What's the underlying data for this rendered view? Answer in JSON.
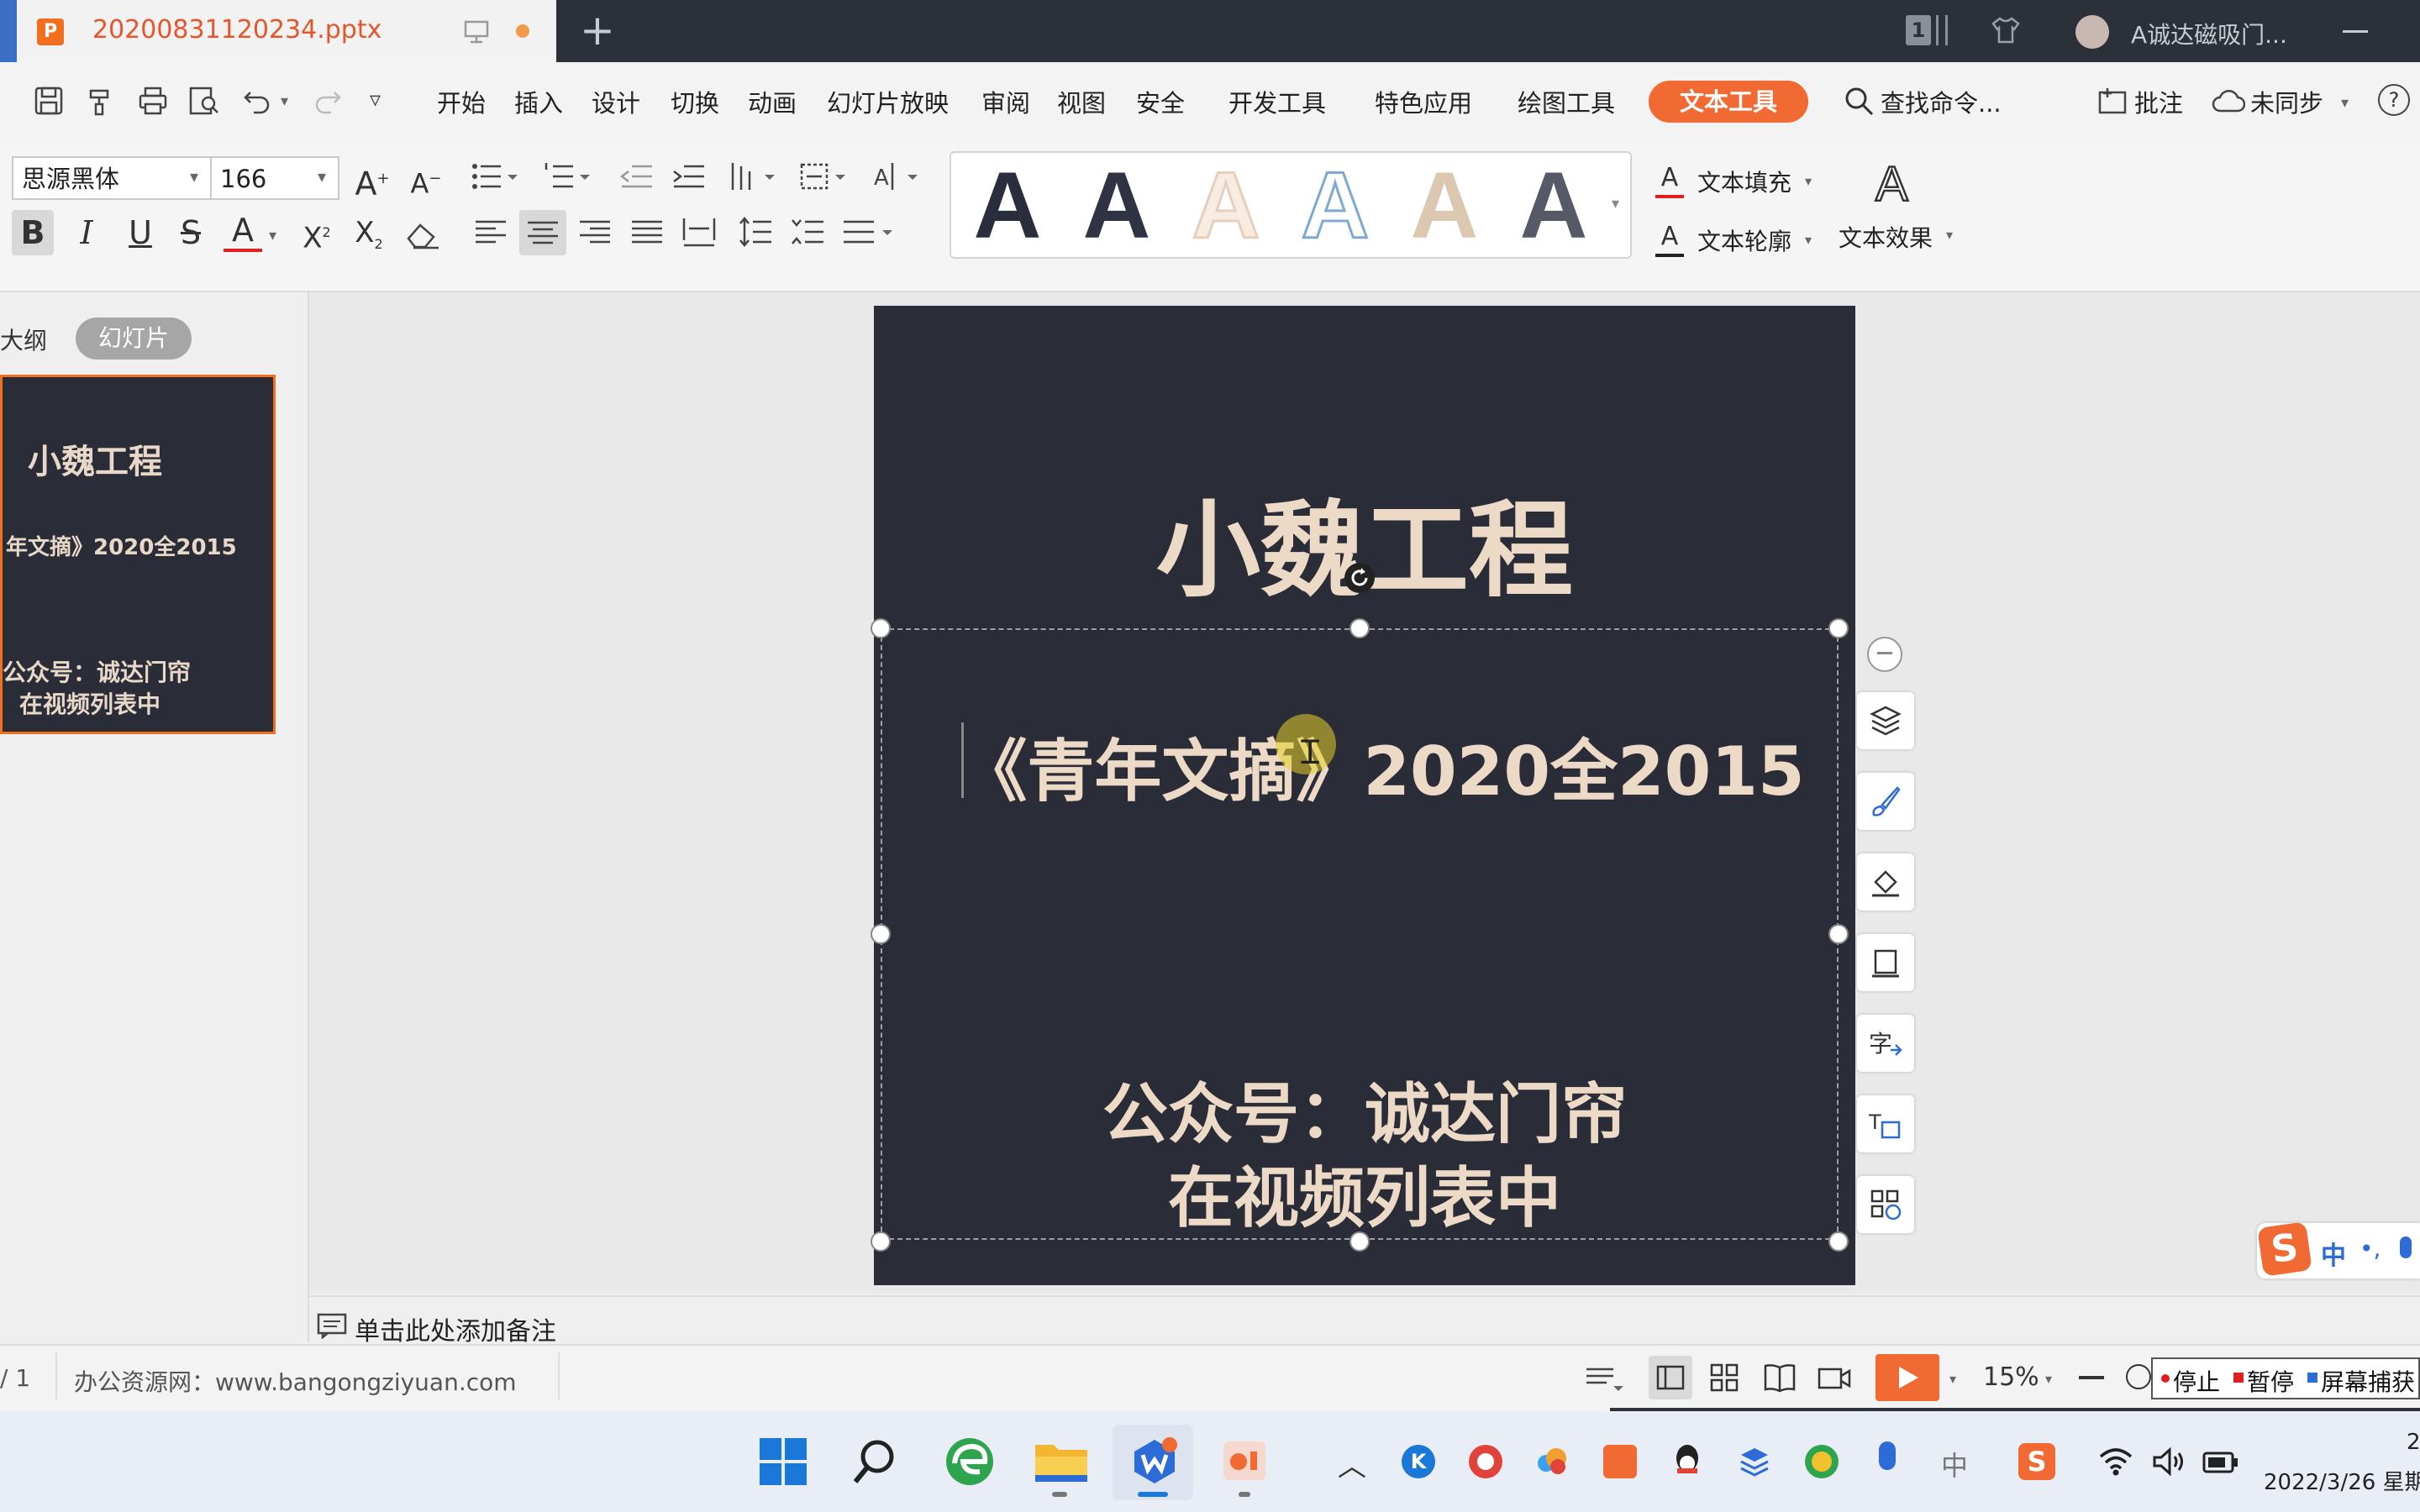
{
  "title_bar": {
    "tab_filename": "20200831120234.pptx",
    "doc_icon_letter": "P",
    "user_label": "A诚达磁吸门...",
    "page_badge": "1"
  },
  "menu": {
    "items": [
      "开始",
      "插入",
      "设计",
      "切换",
      "动画",
      "幻灯片放映",
      "审阅",
      "视图",
      "安全",
      "开发工具",
      "特色应用",
      "绘图工具"
    ],
    "active_tab": "文本工具",
    "search": "查找命令...",
    "comment": "批注",
    "sync": "未同步",
    "help": "?"
  },
  "ribbon": {
    "font_name": "思源黑体",
    "font_size": "166",
    "style_letter": "A",
    "text_fill": "文本填充",
    "text_outline": "文本轮廓",
    "text_effect": "文本效果"
  },
  "left_panel": {
    "tab_outline": "大纲",
    "tab_slides": "幻灯片"
  },
  "slide": {
    "title": "小魏工程",
    "subtitle": "《青年文摘》2020全2015",
    "footer_line1": "公众号：诚达门帘",
    "footer_line2": "在视频列表中",
    "background": "#2a2c38",
    "text_color": "#ecd9c6"
  },
  "thumbnail": {
    "title": "小魏工程",
    "subtitle": "年文摘》2020全2015",
    "line1": "公众号：诚达门帘",
    "line2": "在视频列表中"
  },
  "notes": {
    "placeholder": "单击此处添加备注"
  },
  "status": {
    "page": "/ 1",
    "site": "办公资源网：www.bangongziyuan.com",
    "zoom": "15%",
    "stop": "停止",
    "pause": "暂停",
    "capture": "屏幕捕获"
  },
  "ime": {
    "mode": "中"
  },
  "taskbar": {
    "ime_char": "中",
    "date": "2022/3/26 星期",
    "time_fragment": "2"
  },
  "colors": {
    "accent": "#f26a33",
    "titlebar": "#2c3039"
  }
}
